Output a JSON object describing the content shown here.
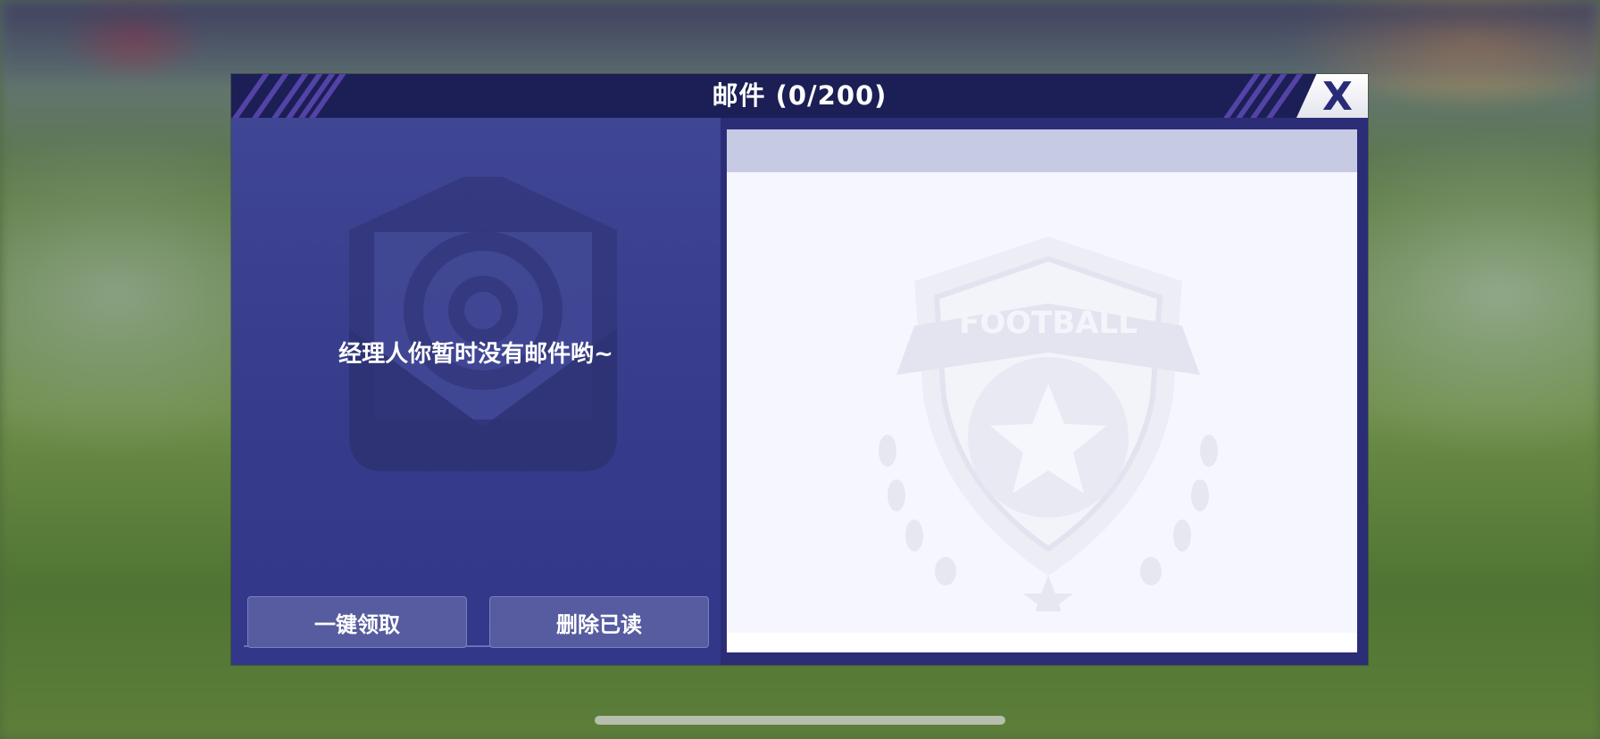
{
  "dialog": {
    "title": "邮件 (0/200)",
    "close_label": "X"
  },
  "mail_list": {
    "empty_message": "经理人你暂时没有邮件哟~"
  },
  "actions": {
    "claim_all_label": "一键领取",
    "delete_read_label": "删除已读"
  },
  "detail": {
    "emblem_text": "FOOTBALL"
  },
  "icons": {
    "close": "close-icon",
    "envelope": "envelope-at-icon",
    "emblem": "football-emblem-icon"
  },
  "colors": {
    "title_bar": "#1b1f55",
    "panel": "#3f4694",
    "accent_stripe": "#5443a7",
    "button": "#565c9f",
    "detail_bg": "#f6f7fe",
    "detail_header": "#c7cae3"
  }
}
